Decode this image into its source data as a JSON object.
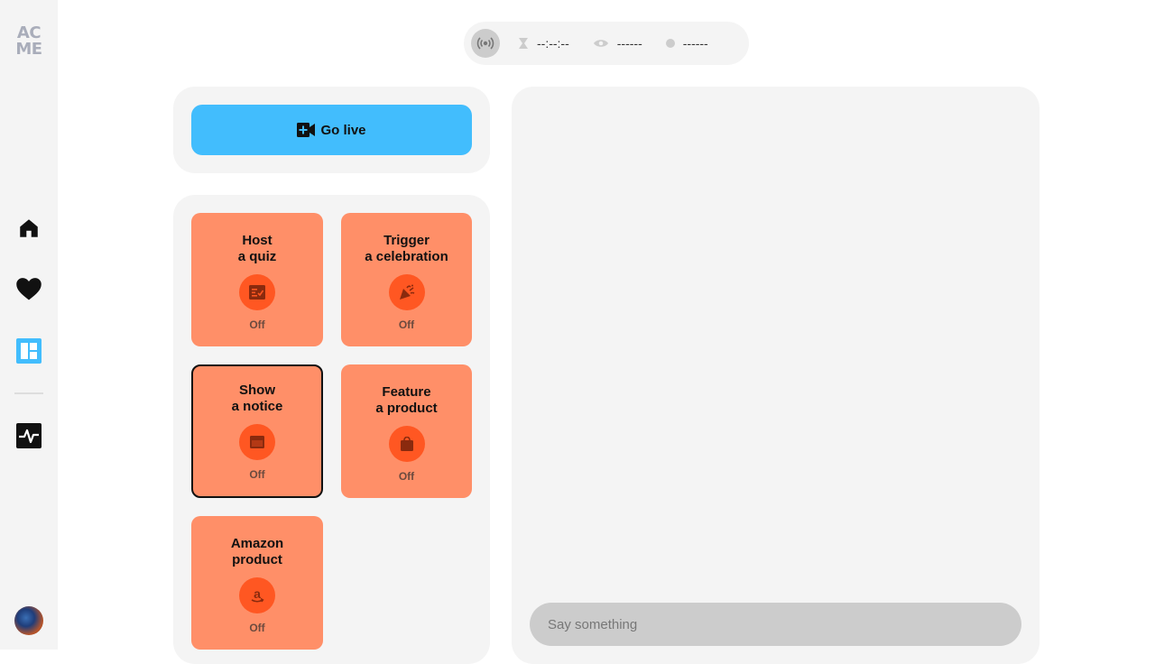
{
  "brand": {
    "logo_line1": "AC",
    "logo_line2": "ME"
  },
  "sidebar": {
    "items": [
      {
        "name": "home",
        "icon": "home-icon"
      },
      {
        "name": "favorites",
        "icon": "heart-icon"
      },
      {
        "name": "dashboard",
        "icon": "dashboard-icon",
        "active": true
      },
      {
        "name": "activity",
        "icon": "pulse-icon"
      }
    ],
    "active_color": "#42bdfd"
  },
  "status_bar": {
    "duration": "--:--:--",
    "viewers": "------",
    "status": "------"
  },
  "golive": {
    "label": "Go live",
    "color": "#42bdfd"
  },
  "cards": [
    {
      "title": "Host\na quiz",
      "status": "Off",
      "icon": "quiz-icon"
    },
    {
      "title": "Trigger\na celebration",
      "status": "Off",
      "icon": "party-popper-icon"
    },
    {
      "title": "Show\na notice",
      "status": "Off",
      "icon": "notice-icon",
      "selected": true
    },
    {
      "title": "Feature\na product",
      "status": "Off",
      "icon": "shopping-bag-icon"
    },
    {
      "title": "Amazon\nproduct",
      "status": "Off",
      "icon": "amazon-icon"
    }
  ],
  "card_colors": {
    "background": "#ff8f68",
    "icon_circle": "#ff5722"
  },
  "chat": {
    "placeholder": "Say something",
    "value": ""
  }
}
